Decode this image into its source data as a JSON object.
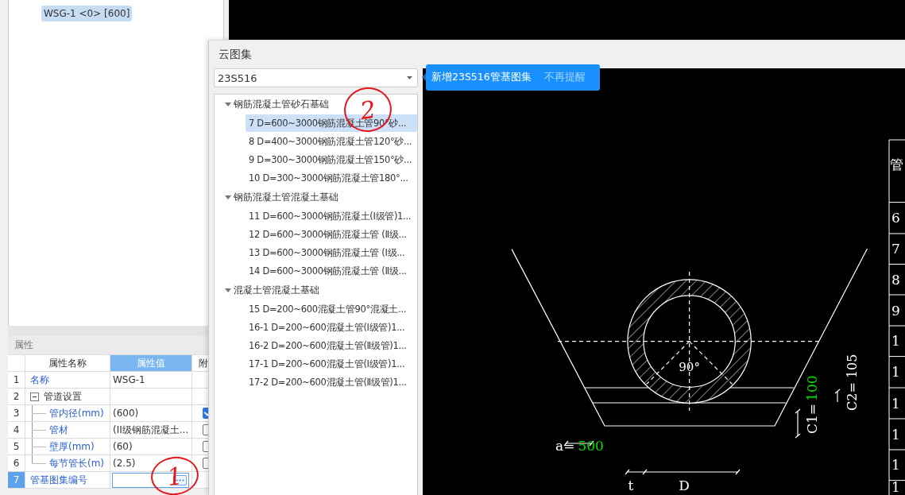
{
  "component_tree": {
    "items": [
      {
        "label": "WSG-1 <0> [600]",
        "selected": true
      }
    ]
  },
  "properties": {
    "title": "属性",
    "columns": [
      "属性名称",
      "属性值",
      "附"
    ],
    "rows": [
      {
        "index": "1",
        "kind": "text",
        "name": "名称",
        "value": "WSG-1",
        "selected": false
      },
      {
        "index": "2",
        "kind": "group",
        "name": "管道设置",
        "expanded": true,
        "selected": false,
        "children": [
          {
            "index": "3",
            "kind": "text",
            "name": "管内径(mm)",
            "value": "(600)",
            "checked": true,
            "selected": false
          },
          {
            "index": "4",
            "kind": "text",
            "name": "管材",
            "value": "(II级钢筋混凝土...",
            "checked": false,
            "selected": false
          },
          {
            "index": "5",
            "kind": "text",
            "name": "壁厚(mm)",
            "value": "(60)",
            "checked": false,
            "selected": false
          },
          {
            "index": "6",
            "kind": "text",
            "name": "每节管长(m)",
            "value": "(2.5)",
            "checked": false,
            "selected": false
          }
        ]
      },
      {
        "index": "7",
        "kind": "browse",
        "name": "管基图集编号",
        "selected": true
      }
    ]
  },
  "dialog": {
    "title": "云图集",
    "atlas_select": {
      "value": "23S516"
    },
    "notice": {
      "text": "新增23S516管基图集",
      "link": "不再提醒"
    },
    "tree": [
      {
        "label": "钢筋混凝土管砂石基础",
        "expanded": true,
        "children": [
          {
            "label": "7 D=600~3000钢筋混凝土管90°砂...",
            "selected": true
          },
          {
            "label": "8 D=400~3000钢筋混凝土管120°砂...",
            "selected": false
          },
          {
            "label": "9 D=300~3000钢筋混凝土管150°砂...",
            "selected": false
          },
          {
            "label": "10 D=300~3000钢筋混凝土管180°...",
            "selected": false
          }
        ]
      },
      {
        "label": "钢筋混凝土管混凝土基础",
        "expanded": true,
        "children": [
          {
            "label": "11 D=600~3000钢筋混凝土(I级管)1...",
            "selected": false
          },
          {
            "label": "12 D=600~3000钢筋混凝土管 (Ⅱ级...",
            "selected": false
          },
          {
            "label": "13 D=600~3000钢筋混凝土管 (Ⅰ级...",
            "selected": false
          },
          {
            "label": "14 D=600~3000钢筋混凝土管 (Ⅱ级...",
            "selected": false
          }
        ]
      },
      {
        "label": "混凝土管混凝土基础",
        "expanded": true,
        "children": [
          {
            "label": "15 D=200~600混凝土管90°混凝土...",
            "selected": false
          },
          {
            "label": "16-1 D=200~600混凝土管(Ⅰ级管)1...",
            "selected": false
          },
          {
            "label": "16-2 D=200~600混凝土管(Ⅱ级管)1...",
            "selected": false
          },
          {
            "label": "17-1 D=200~600混凝土管(Ⅰ级管)1...",
            "selected": false
          },
          {
            "label": "17-2 D=200~600混凝土管(Ⅱ级管)1...",
            "selected": false
          }
        ]
      }
    ],
    "preview": {
      "angle_label": "90°",
      "a_label": "a=",
      "a_value": "500",
      "c1_label": "C1=",
      "c1_value": "100",
      "c2_label": "C2= 105",
      "t_label": "t",
      "d_label": "D",
      "table_header": "管",
      "table_cells": [
        "6",
        "7",
        "8",
        "9",
        "1",
        "1",
        "1",
        "1",
        "1",
        "1"
      ]
    }
  },
  "annotations": [
    {
      "text": "1"
    },
    {
      "text": "2"
    }
  ]
}
